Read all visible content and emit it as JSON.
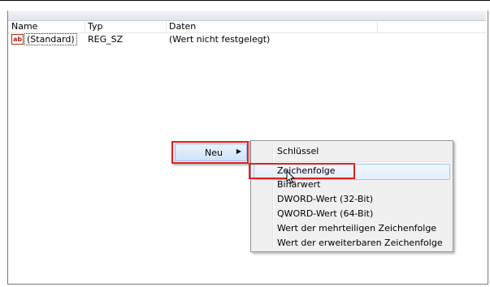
{
  "list": {
    "columns": [
      "Name",
      "Typ",
      "Daten"
    ],
    "rows": [
      {
        "icon": "string-value-icon",
        "icon_text": "ab",
        "name": "(Standard)",
        "type": "REG_SZ",
        "data": "(Wert nicht festgelegt)"
      }
    ]
  },
  "context_menu": {
    "item_label": "Neu"
  },
  "submenu": {
    "items": [
      "Schlüssel",
      "Zeichenfolge",
      "Binärwert",
      "DWORD-Wert (32-Bit)",
      "QWORD-Wert (64-Bit)",
      "Wert der mehrteiligen Zeichenfolge",
      "Wert der erweiterbaren Zeichenfolge"
    ],
    "highlighted_index": 1
  },
  "colors": {
    "highlight_box": "#e02020",
    "menu_bg": "#f0f0f0",
    "selection": "#cfe3f8"
  }
}
